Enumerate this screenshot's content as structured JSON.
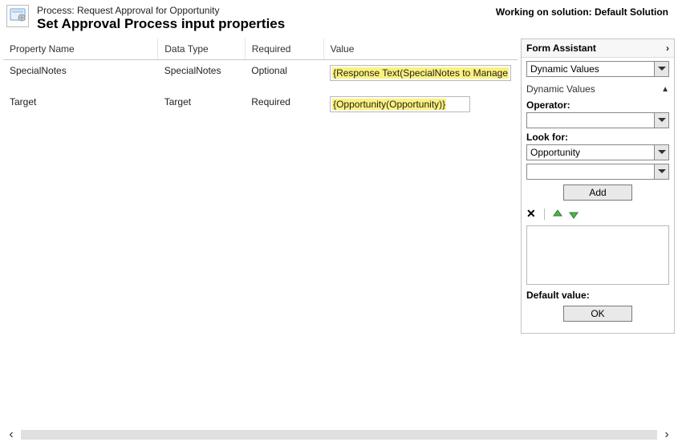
{
  "header": {
    "process_label_prefix": "Process: ",
    "process_name": "Request Approval for Opportunity",
    "title": "Set Approval Process input properties",
    "working_on_prefix": "Working on solution: ",
    "solution_name": "Default Solution"
  },
  "table": {
    "columns": {
      "property_name": "Property Name",
      "data_type": "Data Type",
      "required": "Required",
      "value": "Value"
    },
    "rows": [
      {
        "property_name": "SpecialNotes",
        "data_type": "SpecialNotes",
        "required": "Optional",
        "value_text": "{Response Text(SpecialNotes to Manage"
      },
      {
        "property_name": "Target",
        "data_type": "Target",
        "required": "Required",
        "value_text": "{Opportunity(Opportunity)}"
      }
    ]
  },
  "assistant": {
    "title": "Form Assistant",
    "top_select": "Dynamic Values",
    "section_title": "Dynamic Values",
    "operator_label": "Operator:",
    "operator_value": "",
    "look_for_label": "Look for:",
    "look_for_value": "Opportunity",
    "look_for_secondary": "",
    "add_button": "Add",
    "default_value_label": "Default value:",
    "ok_button": "OK"
  },
  "icons": {
    "chevron_down": "▾",
    "chevron_right": "›",
    "chevron_left": "‹",
    "close_x": "✕",
    "triangle_up": "▲"
  }
}
